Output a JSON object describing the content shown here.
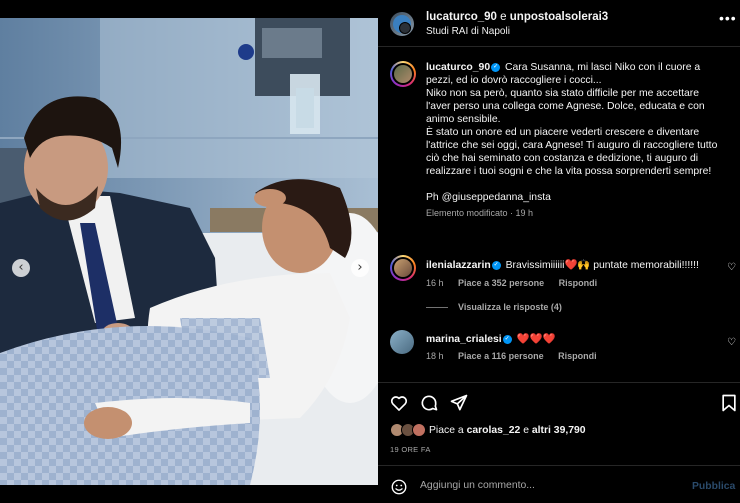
{
  "post": {
    "header": {
      "author": "lucaturco_90",
      "joiner": "e",
      "coauthor": "unpostoalsolerai3",
      "location": "Studi RAI di Napoli",
      "more_icon": "more-horizontal-icon"
    },
    "caption": {
      "author": "lucaturco_90",
      "lines": [
        "Cara Susanna, mi lasci Niko con il cuore a pezzi, ed io dovrò raccogliere i cocci...",
        "Niko non sa però, quanto sia stato difficile per me accettare l'aver perso una collega come Agnese. Dolce, educata e con animo sensibile.",
        "È stato un onore ed un piacere vederti crescere e diventare l'attrice che sei oggi, cara Agnese! Ti auguro di raccogliere tutto ciò che hai seminato con costanza e dedizione, ti auguro di realizzare i tuoi sogni e che la vita possa sorprenderti sempre!"
      ],
      "credit": "Ph @giuseppedanna_insta",
      "edited": "Elemento modificato",
      "time": "19 h"
    },
    "comments": [
      {
        "user": "ilenialazzarin",
        "text": "Bravissimiiiiii❤️🙌 puntate memorabili!!!!!!",
        "time": "16 h",
        "likes": "Piace a 352 persone",
        "reply": "Rispondi",
        "view_replies": "Visualizza le risposte (4)"
      },
      {
        "user": "marina_crialesi",
        "text": "❤️❤️❤️",
        "time": "18 h",
        "likes": "Piace a 116 persone",
        "reply": "Rispondi"
      }
    ],
    "likes": {
      "prefix": "Piace a",
      "user": "carolas_22",
      "middle": "e",
      "others": "altri 39,790"
    },
    "time_ago": "19 ORE FA",
    "comment_box": {
      "placeholder": "Aggiungi un commento...",
      "publish": "Pubblica"
    },
    "carousel": {
      "slide_count": 6,
      "active_slide": 5
    },
    "colors": {
      "verified": "#0095f6",
      "publish_disabled": "#2a4a6a",
      "meta": "#a8a8a8"
    }
  }
}
